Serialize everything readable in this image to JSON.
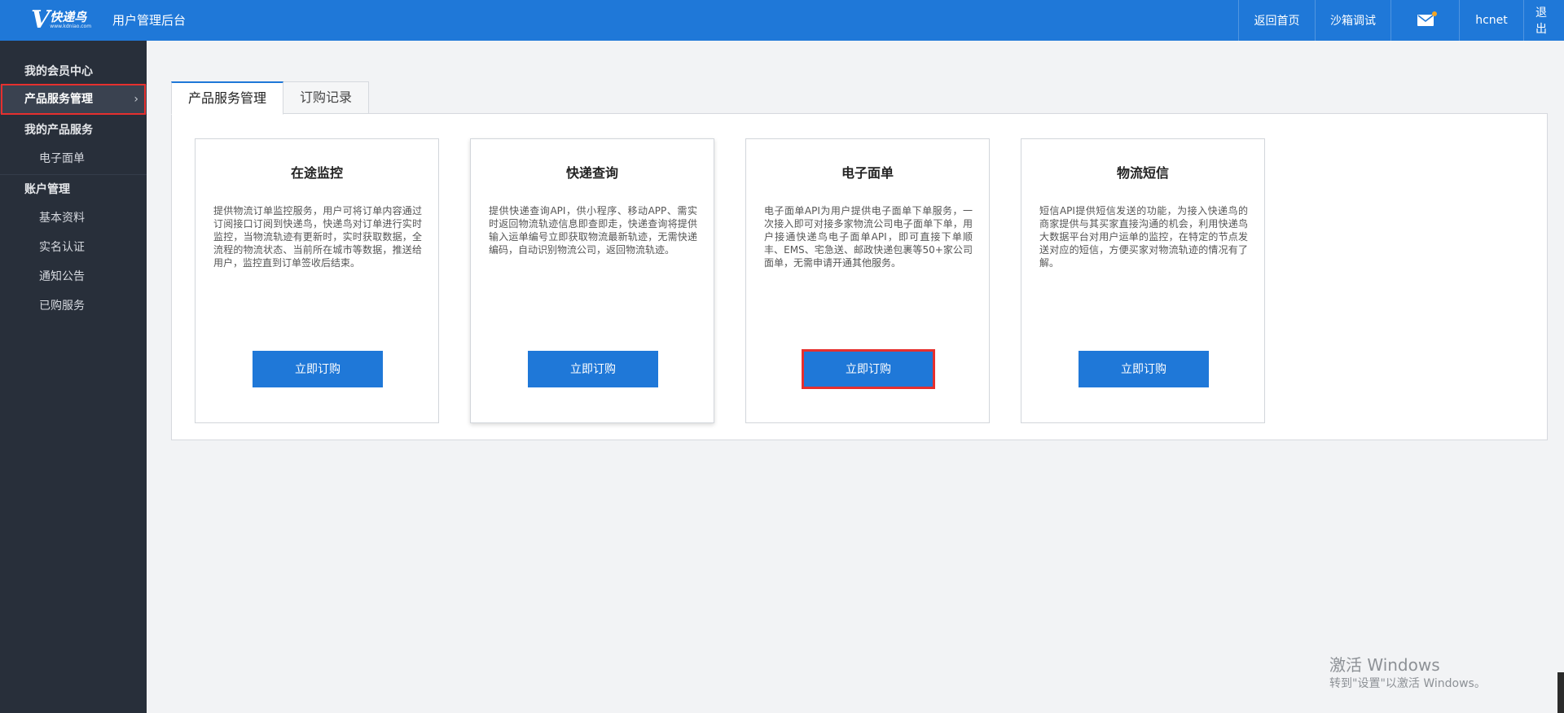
{
  "header": {
    "logo_mark": "V",
    "logo_name": "快递鸟",
    "logo_url": "www.kdniao.com",
    "app_title": "用户管理后台",
    "nav": {
      "home": "返回首页",
      "sandbox": "沙箱调试",
      "user": "hcnet",
      "logout": "退出"
    },
    "mail_icon": "mail-icon",
    "notification_dot_color": "#f4a523"
  },
  "sidebar": {
    "member_center": "我的会员中心",
    "product_service_mgmt": "产品服务管理",
    "product_service_arrow": "›",
    "my_products": "我的产品服务",
    "e_waybill": "电子面单",
    "account_mgmt": "账户管理",
    "basic_info": "基本资料",
    "real_name": "实名认证",
    "notices": "通知公告",
    "purchased": "已购服务"
  },
  "tabs": {
    "active": "产品服务管理",
    "records": "订购记录"
  },
  "cards": [
    {
      "title": "在途监控",
      "desc": "提供物流订单监控服务，用户可将订单内容通过订阅接口订阅到快递鸟，快递鸟对订单进行实时监控，当物流轨迹有更新时，实时获取数据，全流程的物流状态、当前所在城市等数据，推送给用户，监控直到订单签收后结束。",
      "button": "立即订购"
    },
    {
      "title": "快递查询",
      "desc": "提供快递查询API，供小程序、移动APP、需实时返回物流轨迹信息即查即走，快递查询将提供输入运单编号立即获取物流最新轨迹，无需快递编码，自动识别物流公司，返回物流轨迹。",
      "button": "立即订购"
    },
    {
      "title": "电子面单",
      "desc": "电子面单API为用户提供电子面单下单服务，一次接入即可对接多家物流公司电子面单下单，用户接通快递鸟电子面单API，即可直接下单顺丰、EMS、宅急送、邮政快递包裹等50+家公司面单，无需申请开通其他服务。",
      "button": "立即订购"
    },
    {
      "title": "物流短信",
      "desc": "短信API提供短信发送的功能，为接入快递鸟的商家提供与其买家直接沟通的机会，利用快递鸟大数据平台对用户运单的监控，在特定的节点发送对应的短信，方便买家对物流轨迹的情况有了解。",
      "button": "立即订购"
    }
  ],
  "watermark": {
    "title": "激活 Windows",
    "subtitle": "转到\"设置\"以激活 Windows。"
  },
  "colors": {
    "brand": "#1f78d8",
    "sidebar_bg": "#282f3a",
    "highlight": "#e6302e"
  }
}
